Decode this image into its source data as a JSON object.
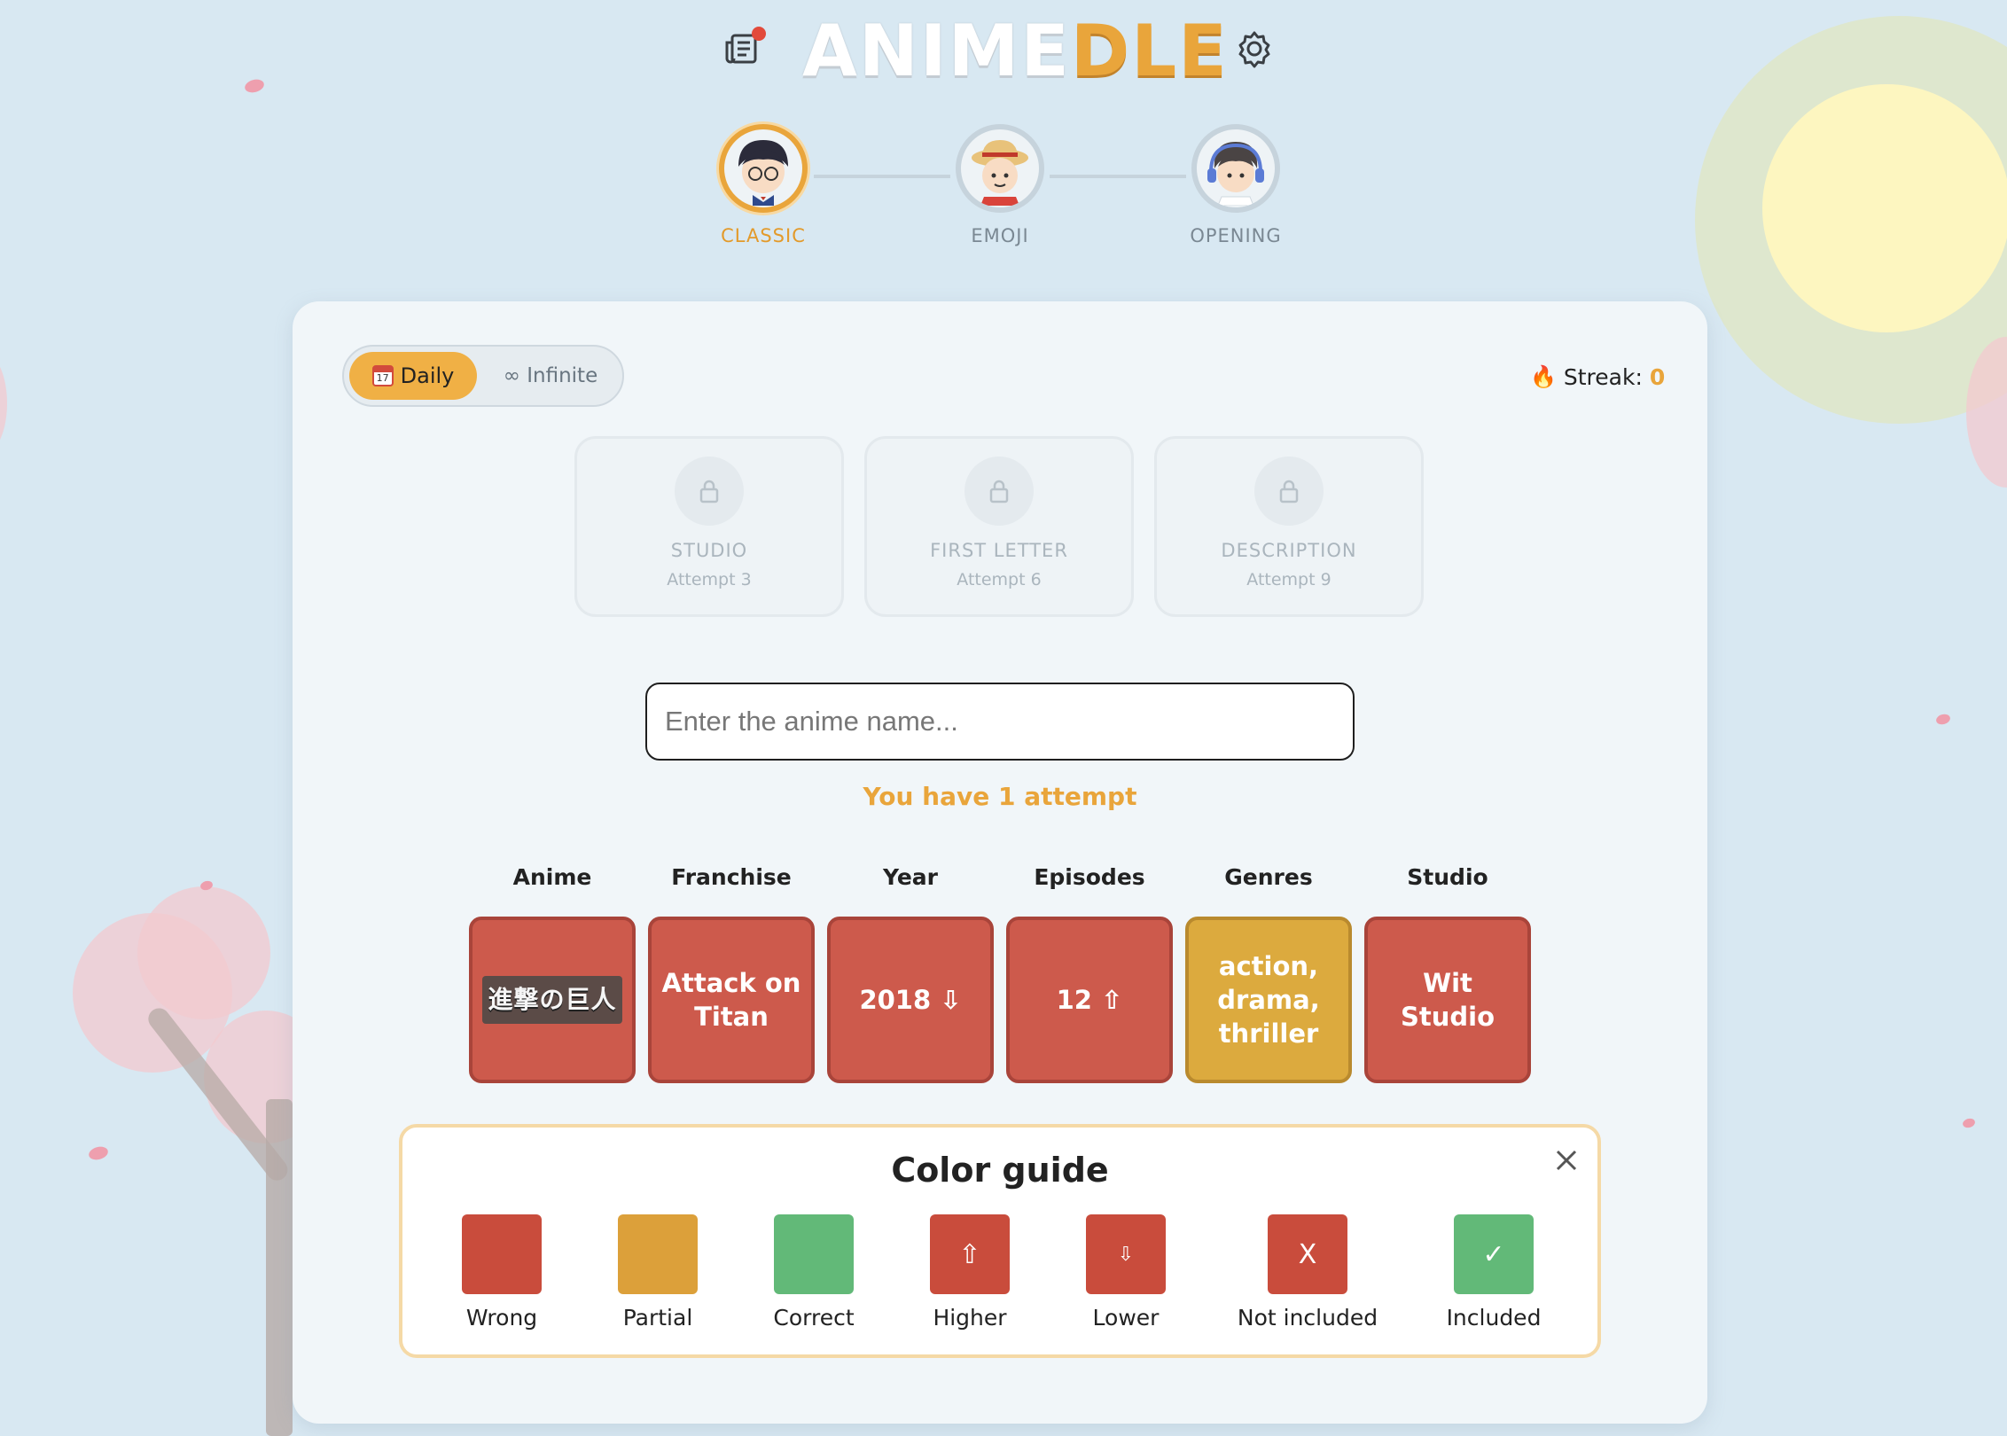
{
  "header": {
    "logo_part1": "ANIME",
    "logo_part2": "DLE",
    "news_icon": "news-icon",
    "settings_icon": "gear-icon"
  },
  "modes": [
    {
      "label": "CLASSIC",
      "active": true
    },
    {
      "label": "EMOJI",
      "active": false
    },
    {
      "label": "OPENING",
      "active": false
    }
  ],
  "toggle": {
    "daily_label": "Daily",
    "calendar_day": "17",
    "infinite_label": "∞ Infinite"
  },
  "streak": {
    "label": "Streak:",
    "value": "0",
    "icon": "🔥"
  },
  "hints": [
    {
      "title": "STUDIO",
      "sub": "Attempt 3"
    },
    {
      "title": "FIRST LETTER",
      "sub": "Attempt 6"
    },
    {
      "title": "DESCRIPTION",
      "sub": "Attempt 9"
    }
  ],
  "search": {
    "placeholder": "Enter the anime name...",
    "value": ""
  },
  "attempts_text": "You have 1 attempt",
  "columns": [
    "Anime",
    "Franchise",
    "Year",
    "Episodes",
    "Genres",
    "Studio"
  ],
  "guess": {
    "anime_logo_text": "進撃の巨人",
    "franchise": "Attack on Titan",
    "year": "2018 ⇩",
    "episodes": "12 ⇧",
    "genres": "action, drama, thriller",
    "studio": "Wit Studio"
  },
  "color_guide": {
    "title": "Color guide",
    "items": [
      {
        "label": "Wrong",
        "symbol": "",
        "color": "#c94c3c"
      },
      {
        "label": "Partial",
        "symbol": "",
        "color": "#dca03a"
      },
      {
        "label": "Correct",
        "symbol": "",
        "color": "#62b978"
      },
      {
        "label": "Higher",
        "symbol": "⇧",
        "color": "#c94c3c"
      },
      {
        "label": "Lower",
        "symbol": "⇩",
        "color": "#c94c3c"
      },
      {
        "label": "Not included",
        "symbol": "X",
        "color": "#c94c3c"
      },
      {
        "label": "Included",
        "symbol": "✓",
        "color": "#62b978"
      }
    ]
  },
  "colors": {
    "accent": "#e9a53b",
    "wrong": "#cd5a4c",
    "partial": "#dcaa3e",
    "correct": "#62b978"
  }
}
